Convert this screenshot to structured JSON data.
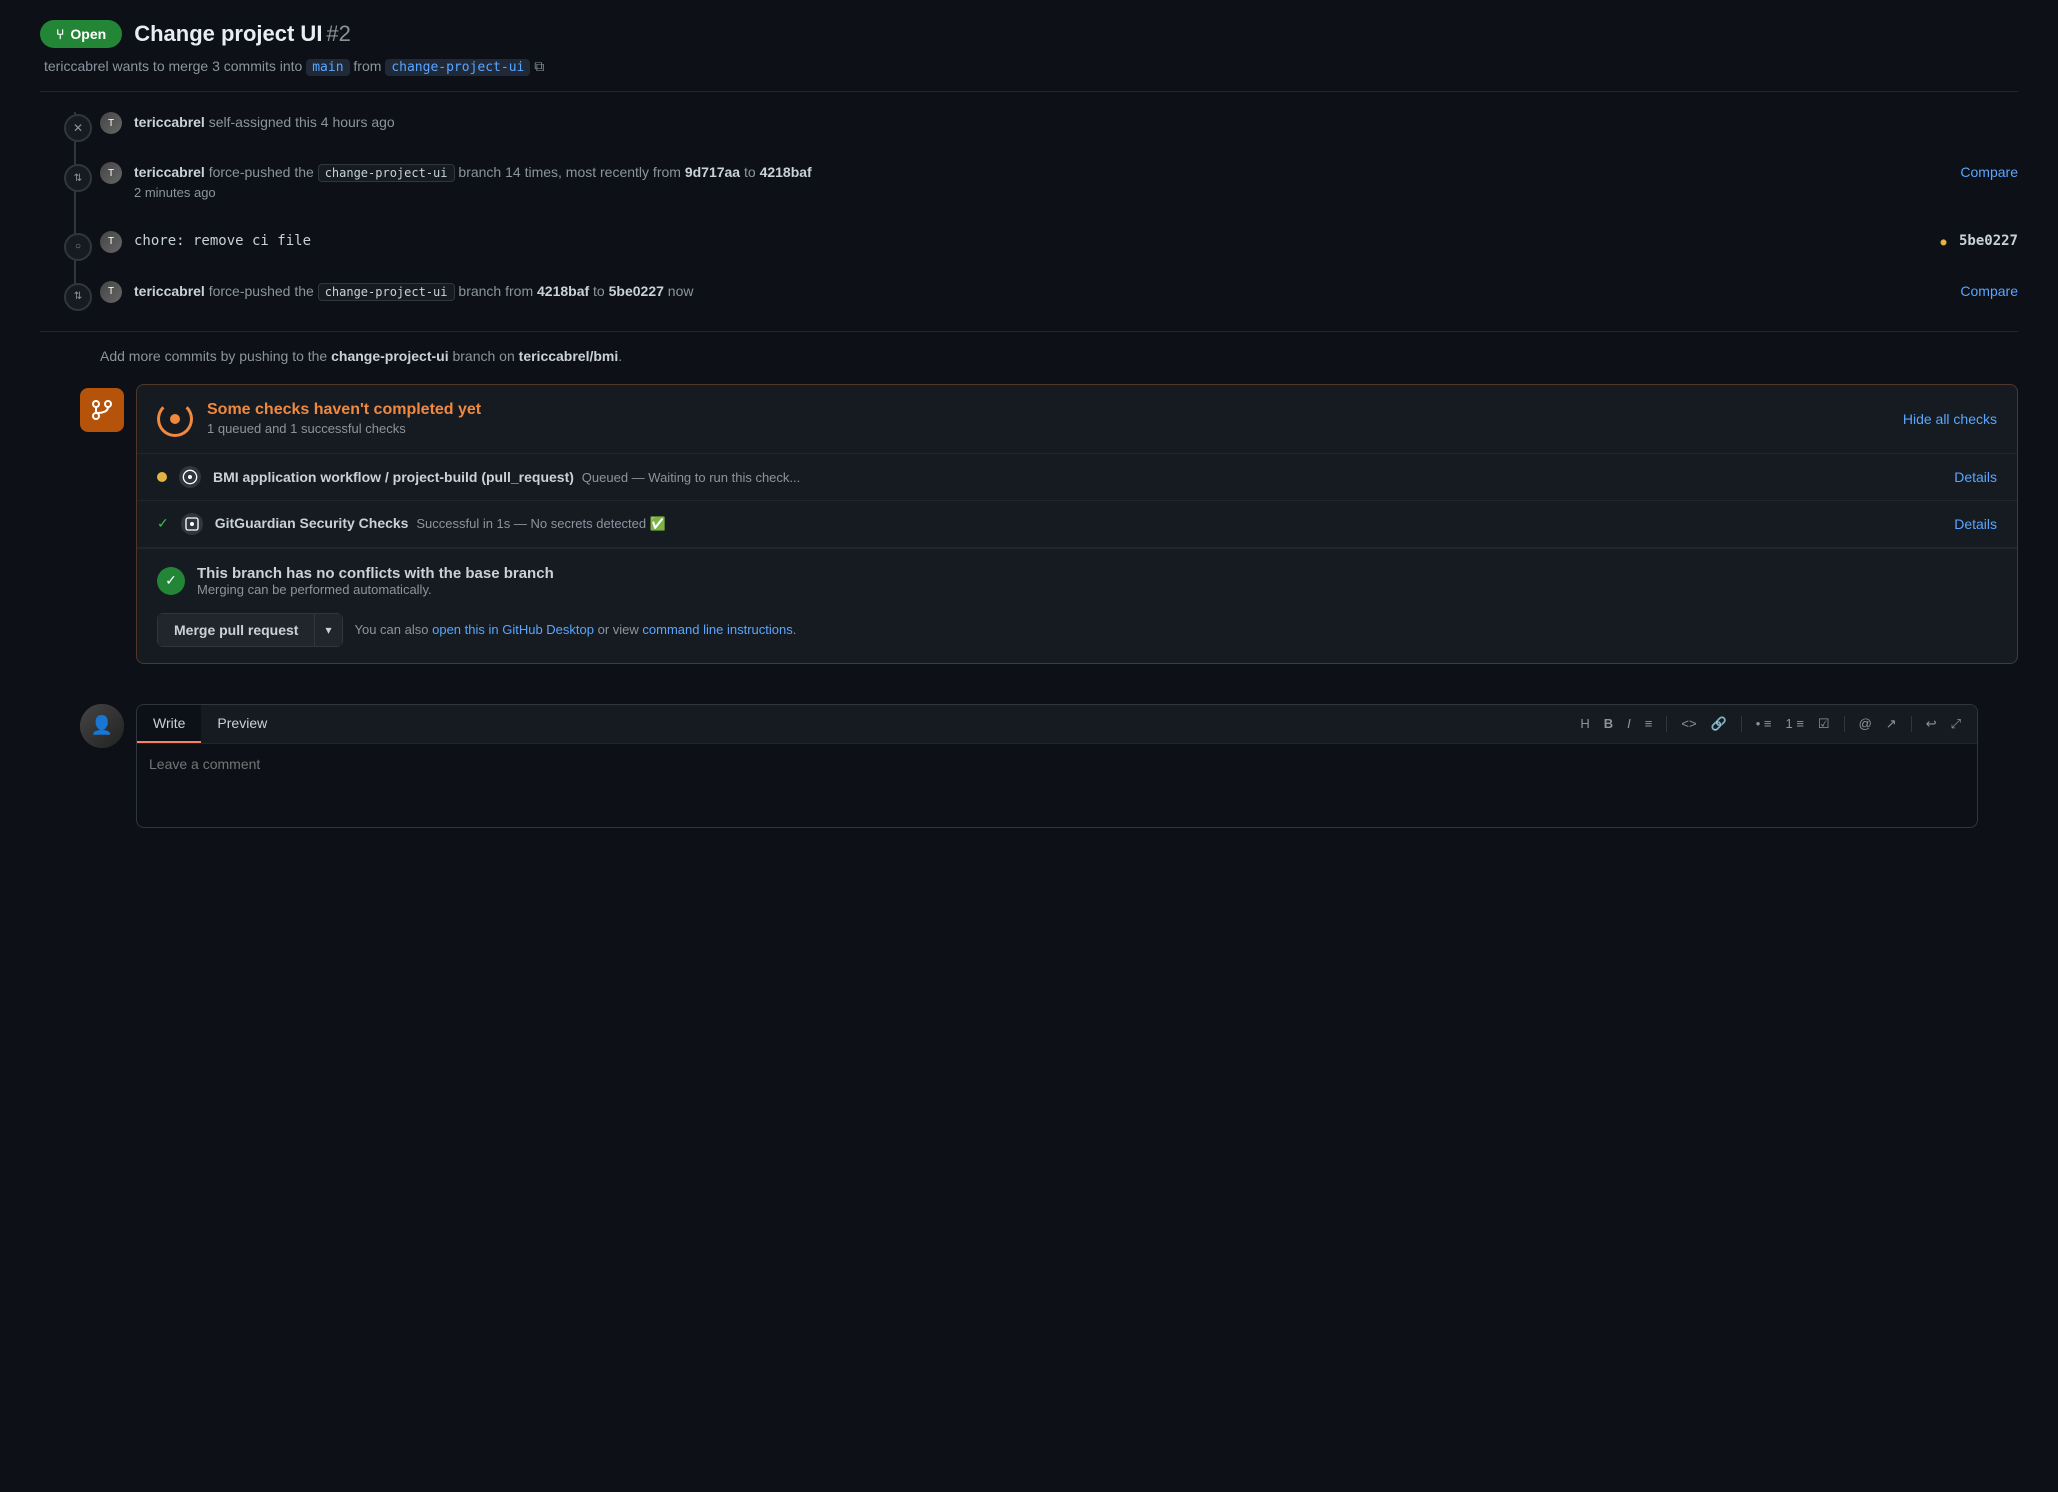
{
  "header": {
    "open_badge": "Open",
    "open_badge_icon": "git-pull-request-icon",
    "title": "Change project UI",
    "pr_number": "#2",
    "subtitle_prefix": "tericcabrel wants to merge 3 commits into",
    "base_branch": "main",
    "from_label": "from",
    "head_branch": "change-project-ui",
    "copy_icon": "copy-icon"
  },
  "timeline": {
    "item1": {
      "actor": "tericcabrel",
      "action": "self-assigned this 4 hours ago"
    },
    "item2": {
      "actor": "tericcabrel",
      "action_prefix": "force-pushed the",
      "branch": "change-project-ui",
      "action_middle": "branch 14 times, most recently from",
      "from_hash": "9d717aa",
      "to_label": "to",
      "to_hash": "4218baf",
      "compare_label": "Compare",
      "timestamp": "2 minutes ago"
    },
    "item3": {
      "message": "chore: remove ci file",
      "hash": "5be0227",
      "hash_color": "#e3b341"
    },
    "item4": {
      "actor": "tericcabrel",
      "action_prefix": "force-pushed the",
      "branch": "change-project-ui",
      "action_middle": "branch from",
      "from_hash": "4218baf",
      "to_label": "to",
      "to_hash": "5be0227",
      "timestamp": "now",
      "compare_label": "Compare"
    }
  },
  "branch_info": {
    "text_prefix": "Add more commits by pushing to the",
    "branch": "change-project-ui",
    "text_suffix": "branch on",
    "repo": "tericcabrel/bmi",
    "punctuation": "."
  },
  "checks": {
    "status_icon": "spinner-icon",
    "title": "Some checks haven't completed yet",
    "subtitle": "1 queued and 1 successful checks",
    "hide_label": "Hide all checks",
    "items": [
      {
        "status": "pending",
        "icon": "github-actions-icon",
        "name": "BMI application workflow / project-build (pull_request)",
        "status_text": "Queued — Waiting to run this check...",
        "details_label": "Details"
      },
      {
        "status": "success",
        "icon": "gitguardian-icon",
        "name": "GitGuardian Security Checks",
        "status_text": "Successful in 1s — No secrets detected ✅",
        "details_label": "Details"
      }
    ]
  },
  "merge": {
    "icon": "check-icon",
    "title": "This branch has no conflicts with the base branch",
    "subtitle": "Merging can be performed automatically.",
    "btn_label": "Merge pull request",
    "btn_dropdown_icon": "chevron-down-icon",
    "info_prefix": "You can also",
    "github_desktop_link": "open this in GitHub Desktop",
    "info_middle": "or view",
    "cli_link": "command line instructions",
    "info_suffix": "."
  },
  "comment": {
    "write_tab": "Write",
    "preview_tab": "Preview",
    "toolbar": {
      "heading": "H",
      "bold": "B",
      "italic": "I",
      "list": "≡",
      "code": "<>",
      "link": "🔗",
      "unordered_list": "• ≡",
      "ordered_list": "1 ≡",
      "task_list": "☑ ≡",
      "mention": "@",
      "ref": "↗",
      "undo": "↩",
      "fullscreen": "⤢"
    },
    "placeholder": "Leave a comment"
  },
  "colors": {
    "accent_blue": "#58a6ff",
    "accent_orange": "#f0883e",
    "accent_green": "#238636",
    "accent_yellow": "#e3b341",
    "border": "#30363d",
    "bg_secondary": "#161b22",
    "text_muted": "#8b949e"
  }
}
